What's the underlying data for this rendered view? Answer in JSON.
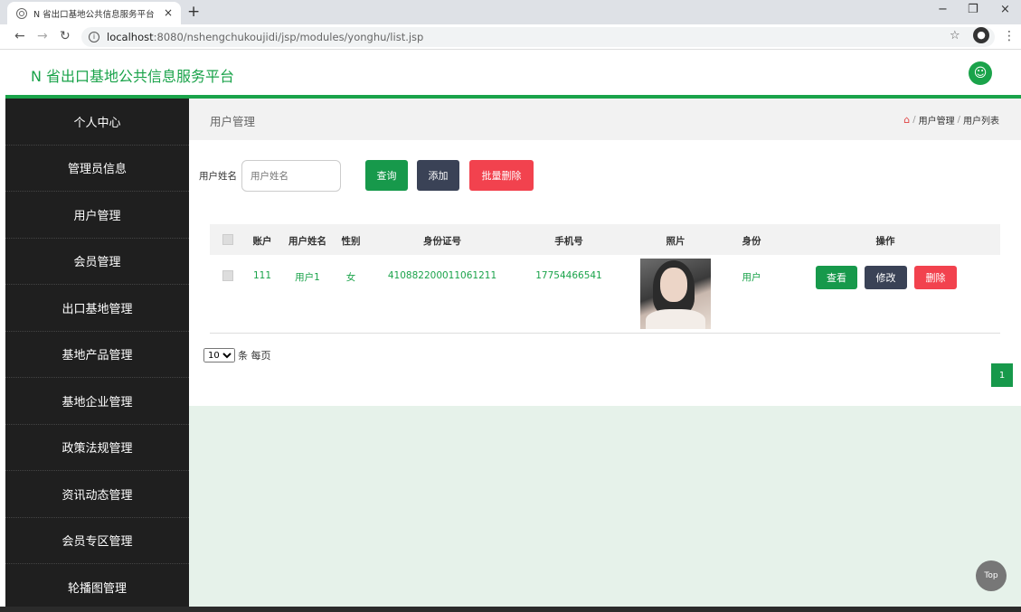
{
  "browser": {
    "tab_title": "N 省出口基地公共信息服务平台",
    "tab_close": "×",
    "new_tab": "+",
    "url_host": "localhost",
    "url_port_path": ":8080/nshengchukoujidi/jsp/modules/yonghu/list.jsp",
    "win_min": "−",
    "win_max": "❐",
    "win_close": "×"
  },
  "app": {
    "title": "N 省出口基地公共信息服务平台"
  },
  "sidebar": {
    "items": [
      {
        "label": "个人中心"
      },
      {
        "label": "管理员信息"
      },
      {
        "label": "用户管理"
      },
      {
        "label": "会员管理"
      },
      {
        "label": "出口基地管理"
      },
      {
        "label": "基地产品管理"
      },
      {
        "label": "基地企业管理"
      },
      {
        "label": "政策法规管理"
      },
      {
        "label": "资讯动态管理"
      },
      {
        "label": "会员专区管理"
      },
      {
        "label": "轮播图管理"
      }
    ]
  },
  "header": {
    "page_title": "用户管理",
    "breadcrumb": [
      "用户管理",
      "用户列表"
    ],
    "breadcrumb_sep": "/"
  },
  "search": {
    "label": "用户姓名",
    "placeholder": "用户姓名",
    "query_btn": "查询",
    "add_btn": "添加",
    "batch_delete_btn": "批量删除"
  },
  "table": {
    "columns": [
      "账户",
      "用户姓名",
      "性别",
      "身份证号",
      "手机号",
      "照片",
      "身份",
      "操作"
    ],
    "rows": [
      {
        "account": "111",
        "name": "用户1",
        "gender": "女",
        "id_number": "410882200011061211",
        "phone": "17754466541",
        "role": "用户",
        "view_btn": "查看",
        "edit_btn": "修改",
        "delete_btn": "删除"
      }
    ]
  },
  "pagination": {
    "page_size": "10",
    "page_size_suffix": "条 每页",
    "current_page": "1"
  },
  "top_button": "Top",
  "colors": {
    "accent": "#1aa34a",
    "sidebar_bg": "#1f1f1f",
    "danger": "#f2424e",
    "dark_button": "#3a4256"
  }
}
